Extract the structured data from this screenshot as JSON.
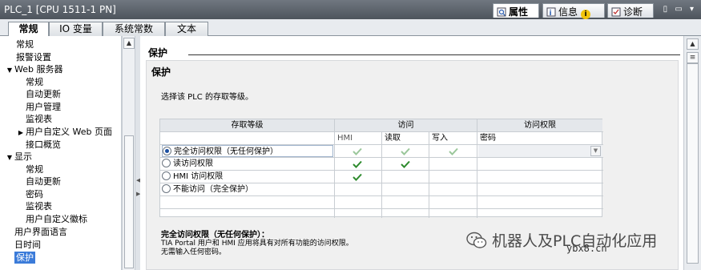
{
  "window": {
    "title": "PLC_1 [CPU 1511-1 PN]",
    "panel_tabs": [
      "属性",
      "信息",
      "诊断"
    ],
    "info_badge": "i",
    "controls": "▯ ▭ ▾"
  },
  "tabs": [
    "常规",
    "IO 变量",
    "系统常数",
    "文本"
  ],
  "nav": {
    "items": [
      {
        "label": "常规",
        "arrow": ""
      },
      {
        "label": "报警设置",
        "arrow": ""
      },
      {
        "label": "Web 服务器",
        "arrow": "▼"
      },
      {
        "label": "常规",
        "arrow": ""
      },
      {
        "label": "自动更新",
        "arrow": ""
      },
      {
        "label": "用户管理",
        "arrow": ""
      },
      {
        "label": "监视表",
        "arrow": ""
      },
      {
        "label": "用户自定义 Web 页面",
        "arrow": "▶"
      },
      {
        "label": "接口概览",
        "arrow": ""
      },
      {
        "label": "显示",
        "arrow": "▼"
      },
      {
        "label": "常规",
        "arrow": ""
      },
      {
        "label": "自动更新",
        "arrow": ""
      },
      {
        "label": "密码",
        "arrow": ""
      },
      {
        "label": "监视表",
        "arrow": ""
      },
      {
        "label": "用户自定义徽标",
        "arrow": ""
      },
      {
        "label": "用户界面语言",
        "arrow": ""
      },
      {
        "label": "日时间",
        "arrow": ""
      },
      {
        "label": "保护",
        "arrow": ""
      }
    ],
    "selected": "保护"
  },
  "main": {
    "section_title": "保护",
    "subsection_title": "保护",
    "description": "选择该 PLC 的存取等级。",
    "grid": {
      "headers": {
        "level": "存取等级",
        "access": "访问",
        "permission": "访问权限",
        "hmi": "HMI",
        "read": "读取",
        "write": "写入",
        "password": "密码"
      },
      "rows": [
        {
          "label": "完全访问权限（无任何保护）",
          "selected": true,
          "hmi": true,
          "read": true,
          "write": true
        },
        {
          "label": "读访问权限",
          "selected": false,
          "hmi": true,
          "read": true,
          "write": false
        },
        {
          "label": "HMI 访问权限",
          "selected": false,
          "hmi": true,
          "read": false,
          "write": false
        },
        {
          "label": "不能访问（完全保护）",
          "selected": false,
          "hmi": false,
          "read": false,
          "write": false
        }
      ]
    },
    "selected_desc_title": "完全访问权限（无任何保护）：",
    "selected_desc_line1": "TIA Portal 用户和 HMI 应用将具有对所有功能的访问权限。",
    "selected_desc_line2": "无需输入任何密码。"
  },
  "watermark": {
    "text": "机器人及PLC自动化应用",
    "site": "ybx8.cn"
  },
  "colors": {
    "accent": "#3b7bd9",
    "check": "#2e8b2e",
    "titlebar": "#5a6169"
  }
}
